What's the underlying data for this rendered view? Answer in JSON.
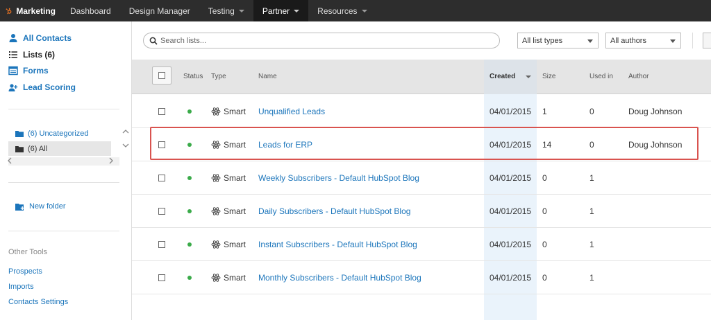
{
  "topnav": {
    "brand": "Marketing",
    "items": [
      {
        "label": "Dashboard",
        "has_caret": false,
        "active": false
      },
      {
        "label": "Design Manager",
        "has_caret": false,
        "active": false
      },
      {
        "label": "Testing",
        "has_caret": true,
        "active": false
      },
      {
        "label": "Partner",
        "has_caret": true,
        "active": true
      },
      {
        "label": "Resources",
        "has_caret": true,
        "active": false
      }
    ]
  },
  "sidebar": {
    "links": [
      {
        "label": "All Contacts",
        "icon": "person-icon"
      },
      {
        "label": "Lists (6)",
        "icon": "list-icon"
      },
      {
        "label": "Forms",
        "icon": "form-icon"
      },
      {
        "label": "Lead Scoring",
        "icon": "person-plus-icon"
      }
    ],
    "folders": [
      {
        "label": "(6) Uncategorized"
      },
      {
        "label": "(6) All"
      }
    ],
    "new_folder": "New folder",
    "other_tools_heading": "Other Tools",
    "tools": [
      "Prospects",
      "Imports",
      "Contacts Settings"
    ]
  },
  "toolbar": {
    "search_placeholder": "Search lists...",
    "list_type_selected": "All list types",
    "author_selected": "All authors"
  },
  "table": {
    "headers": {
      "status": "Status",
      "type": "Type",
      "name": "Name",
      "created": "Created",
      "size": "Size",
      "used_in": "Used in",
      "author": "Author"
    },
    "rows": [
      {
        "type": "Smart",
        "name": "Unqualified Leads",
        "created": "04/01/2015",
        "size": "1",
        "used_in": "0",
        "author": "Doug Johnson"
      },
      {
        "type": "Smart",
        "name": "Leads for ERP",
        "created": "04/01/2015",
        "size": "14",
        "used_in": "0",
        "author": "Doug Johnson"
      },
      {
        "type": "Smart",
        "name": "Weekly Subscribers - Default HubSpot Blog",
        "created": "04/01/2015",
        "size": "0",
        "used_in": "1",
        "author": ""
      },
      {
        "type": "Smart",
        "name": "Daily Subscribers - Default HubSpot Blog",
        "created": "04/01/2015",
        "size": "0",
        "used_in": "1",
        "author": ""
      },
      {
        "type": "Smart",
        "name": "Instant Subscribers - Default HubSpot Blog",
        "created": "04/01/2015",
        "size": "0",
        "used_in": "1",
        "author": ""
      },
      {
        "type": "Smart",
        "name": "Monthly Subscribers - Default HubSpot Blog",
        "created": "04/01/2015",
        "size": "0",
        "used_in": "1",
        "author": ""
      }
    ]
  },
  "colors": {
    "accent": "#1b75bb",
    "nav_bg": "#2d2d2d",
    "status_active": "#3bab4a",
    "highlight": "#d9534f"
  }
}
